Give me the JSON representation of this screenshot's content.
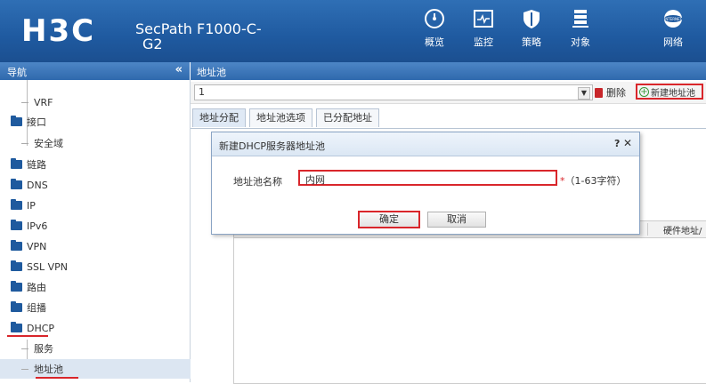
{
  "header": {
    "logo": "H3C",
    "product_line1": "SecPath F1000-C-",
    "product_line2": "G2",
    "nav": [
      {
        "label": "概览",
        "icon": "dashboard-icon"
      },
      {
        "label": "监控",
        "icon": "monitor-icon"
      },
      {
        "label": "策略",
        "icon": "shield-icon"
      },
      {
        "label": "对象",
        "icon": "object-icon"
      },
      {
        "label": "网络",
        "icon": "network-icon"
      }
    ]
  },
  "sidebar": {
    "title": "导航",
    "collapse": "«",
    "items": [
      {
        "label": "VRF",
        "type": "sub"
      },
      {
        "label": "接口",
        "type": "folder"
      },
      {
        "label": "安全域",
        "type": "sub"
      },
      {
        "label": "链路",
        "type": "folder"
      },
      {
        "label": "DNS",
        "type": "folder"
      },
      {
        "label": "IP",
        "type": "folder"
      },
      {
        "label": "IPv6",
        "type": "folder"
      },
      {
        "label": "VPN",
        "type": "folder"
      },
      {
        "label": "SSL VPN",
        "type": "folder"
      },
      {
        "label": "路由",
        "type": "folder"
      },
      {
        "label": "组播",
        "type": "folder"
      },
      {
        "label": "DHCP",
        "type": "folder-open"
      },
      {
        "label": "服务",
        "type": "sub"
      },
      {
        "label": "地址池",
        "type": "sub-selected"
      }
    ]
  },
  "main": {
    "title": "地址池",
    "pool_select": "1",
    "delete_label": "删除",
    "new_label": "新建地址池",
    "tabs": [
      "地址分配",
      "地址池选项",
      "已分配地址"
    ],
    "grid_header_hw": "硬件地址/"
  },
  "dialog": {
    "title": "新建DHCP服务器地址池",
    "help": "?",
    "close": "✕",
    "name_label": "地址池名称",
    "name_value": "内网",
    "required_mark": "*",
    "hint": "（1-63字符）",
    "ok_label": "确定",
    "cancel_label": "取消"
  },
  "colors": {
    "header": "#1f5aa0",
    "highlight": "#d9262b",
    "folder": "#1f5a9e"
  }
}
